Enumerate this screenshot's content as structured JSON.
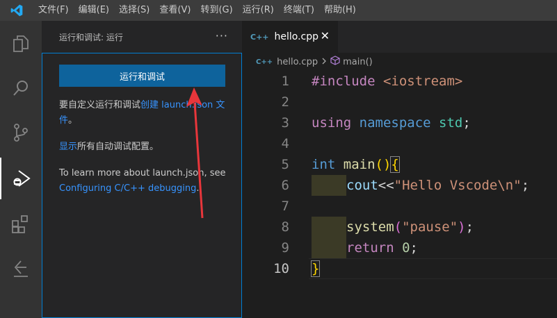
{
  "menubar": {
    "items": [
      "文件(F)",
      "编辑(E)",
      "选择(S)",
      "查看(V)",
      "转到(G)",
      "运行(R)",
      "终端(T)",
      "帮助(H)"
    ]
  },
  "activity_bar": {
    "icons": [
      "files-icon",
      "search-icon",
      "source-control-icon",
      "run-debug-icon",
      "extensions-icon",
      "remote-icon"
    ]
  },
  "sidebar": {
    "title": "运行和调试: 运行",
    "more": "···",
    "run_button": "运行和调试",
    "para1_prefix": "要自定义运行和调试",
    "para1_link": "创建 launch.json 文件",
    "para1_suffix": "。",
    "para2_link": "显示",
    "para2_text": "所有自动调试配置。",
    "para3_text": "To learn more about launch.json, see ",
    "para3_link": "Configuring C/C++ debugging",
    "para3_suffix": "."
  },
  "editor": {
    "tab_icon": "C++",
    "tab_label": "hello.cpp",
    "tab_close": "✕",
    "breadcrumb_file": "hello.cpp",
    "breadcrumb_symbol": "main()",
    "line_numbers": [
      "1",
      "2",
      "3",
      "4",
      "5",
      "6",
      "7",
      "8",
      "9",
      "10"
    ],
    "code": {
      "l1_pp": "#include",
      "l1_str": " <iostream>",
      "l3_using": "using",
      "l3_ns": " namespace",
      "l3_std": " std",
      "l3_semi": ";",
      "l5_type": "int",
      "l5_fn": " main",
      "l5_paren": "()",
      "l5_brace": "{",
      "l6_cout": "cout",
      "l6_op": "<<",
      "l6_str": "\"Hello Vscode\\n\"",
      "l6_semi": ";",
      "l8_fn": "system",
      "l8_open": "(",
      "l8_str": "\"pause\"",
      "l8_close": ")",
      "l8_semi": ";",
      "l9_kw": "return",
      "l9_num": " 0",
      "l9_semi": ";",
      "l10_brace": "}"
    }
  },
  "colors": {
    "accent": "#0e639c",
    "link": "#3794ff",
    "annotation_arrow": "#e8363b"
  }
}
